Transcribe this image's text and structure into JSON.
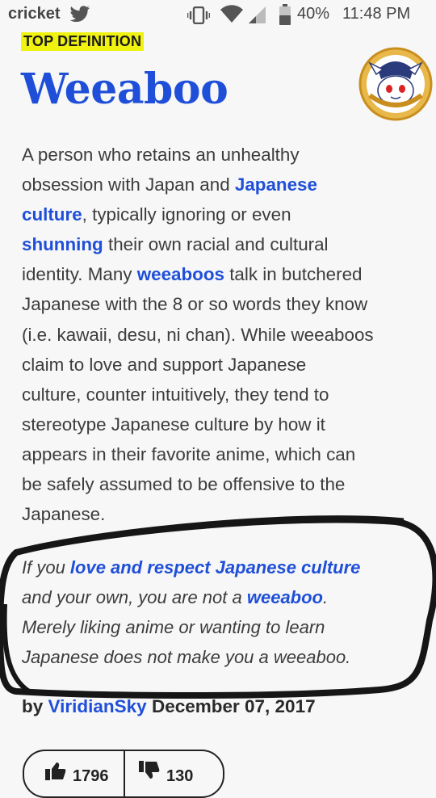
{
  "status_bar": {
    "carrier": "cricket",
    "battery": "40%",
    "time": "11:48 PM"
  },
  "definition": {
    "badge": "TOP DEFINITION",
    "word": "Weeaboo",
    "meaning_lines": [
      [
        {
          "t": "A person who retains an unhealthy"
        }
      ],
      [
        {
          "t": "obsession with Japan and "
        },
        {
          "t": "Japanese",
          "link": true
        }
      ],
      [
        {
          "t": "culture",
          "link": true
        },
        {
          "t": ", typically ignoring or even"
        }
      ],
      [
        {
          "t": "shunning",
          "link": true
        },
        {
          "t": " their own racial and cultural"
        }
      ],
      [
        {
          "t": "identity. Many "
        },
        {
          "t": "weeaboos",
          "link": true
        },
        {
          "t": " talk in butchered"
        }
      ],
      [
        {
          "t": "Japanese with the 8 or so words they know"
        }
      ],
      [
        {
          "t": "(i.e. kawaii, desu, ni chan). While weeaboos"
        }
      ],
      [
        {
          "t": "claim to love and support Japanese"
        }
      ],
      [
        {
          "t": "culture, counter intuitively, they tend to"
        }
      ],
      [
        {
          "t": "stereotype Japanese culture by how it"
        }
      ],
      [
        {
          "t": "appears in their favorite anime, which can"
        }
      ],
      [
        {
          "t": "be safely assumed to be offensive to the"
        }
      ],
      [
        {
          "t": "Japanese."
        }
      ]
    ],
    "example_lines": [
      [
        {
          "t": "If you "
        },
        {
          "t": "love and respect Japanese culture",
          "link": true
        }
      ],
      [
        {
          "t": "and your own, you are not a "
        },
        {
          "t": "weeaboo",
          "link": true
        },
        {
          "t": "."
        }
      ],
      [
        {
          "t": "Merely liking anime or wanting to learn"
        }
      ],
      [
        {
          "t": "Japanese does not make you a weeaboo."
        }
      ]
    ],
    "author_prefix": "by",
    "author": "ViridianSky",
    "date": "December 07, 2017"
  },
  "votes": {
    "up": "1796",
    "down": "130"
  },
  "colors": {
    "link": "#1f4fd8",
    "highlight": "#f0f20f",
    "background": "#f7f7f7"
  }
}
